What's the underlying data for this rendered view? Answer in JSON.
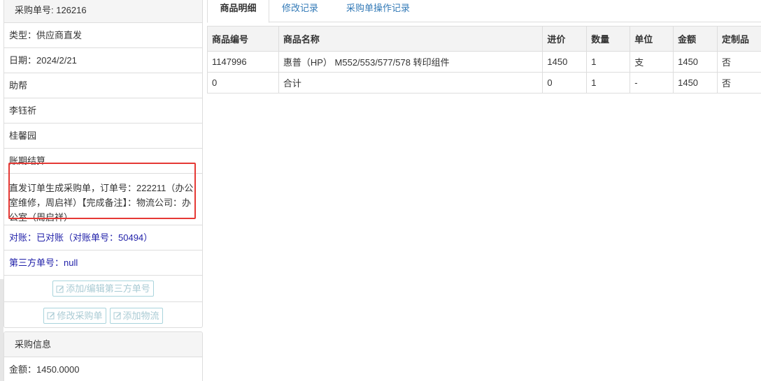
{
  "purchase_panel": {
    "header": "采购单号: 126216",
    "type": "类型：供应商直发",
    "date": "日期：2024/2/21",
    "row3": "助帮",
    "row4": "李钰祈",
    "row5": "桂馨园",
    "row6": "账期结算",
    "note": "直发订单生成采购单，订单号：222211（办公室维修，周启祥）【完成备注】：物流公司：办公室（周启祥）",
    "reconcile": "对账：已对账（对账单号：50494）",
    "third_party": "第三方单号：null",
    "btn_third_party": "添加/编辑第三方单号",
    "btn_edit": "修改采购单",
    "btn_logistics": "添加物流"
  },
  "info_panel": {
    "header": "采购信息",
    "amount": "金额：1450.0000"
  },
  "tabs": [
    "商品明细",
    "修改记录",
    "采购单操作记录"
  ],
  "table": {
    "headers": [
      "商品编号",
      "商品名称",
      "进价",
      "数量",
      "单位",
      "金额",
      "定制品"
    ],
    "rows": [
      [
        "1147996",
        "惠普（HP） M552/553/577/578 转印组件",
        "1450",
        "1",
        "支",
        "1450",
        "否"
      ],
      [
        "0",
        "合计",
        "0",
        "1",
        "-",
        "1450",
        "否"
      ]
    ]
  },
  "colors": {
    "highlight": "#e53935",
    "link": "#337ab7",
    "reconcile": "#1f1fa8"
  }
}
